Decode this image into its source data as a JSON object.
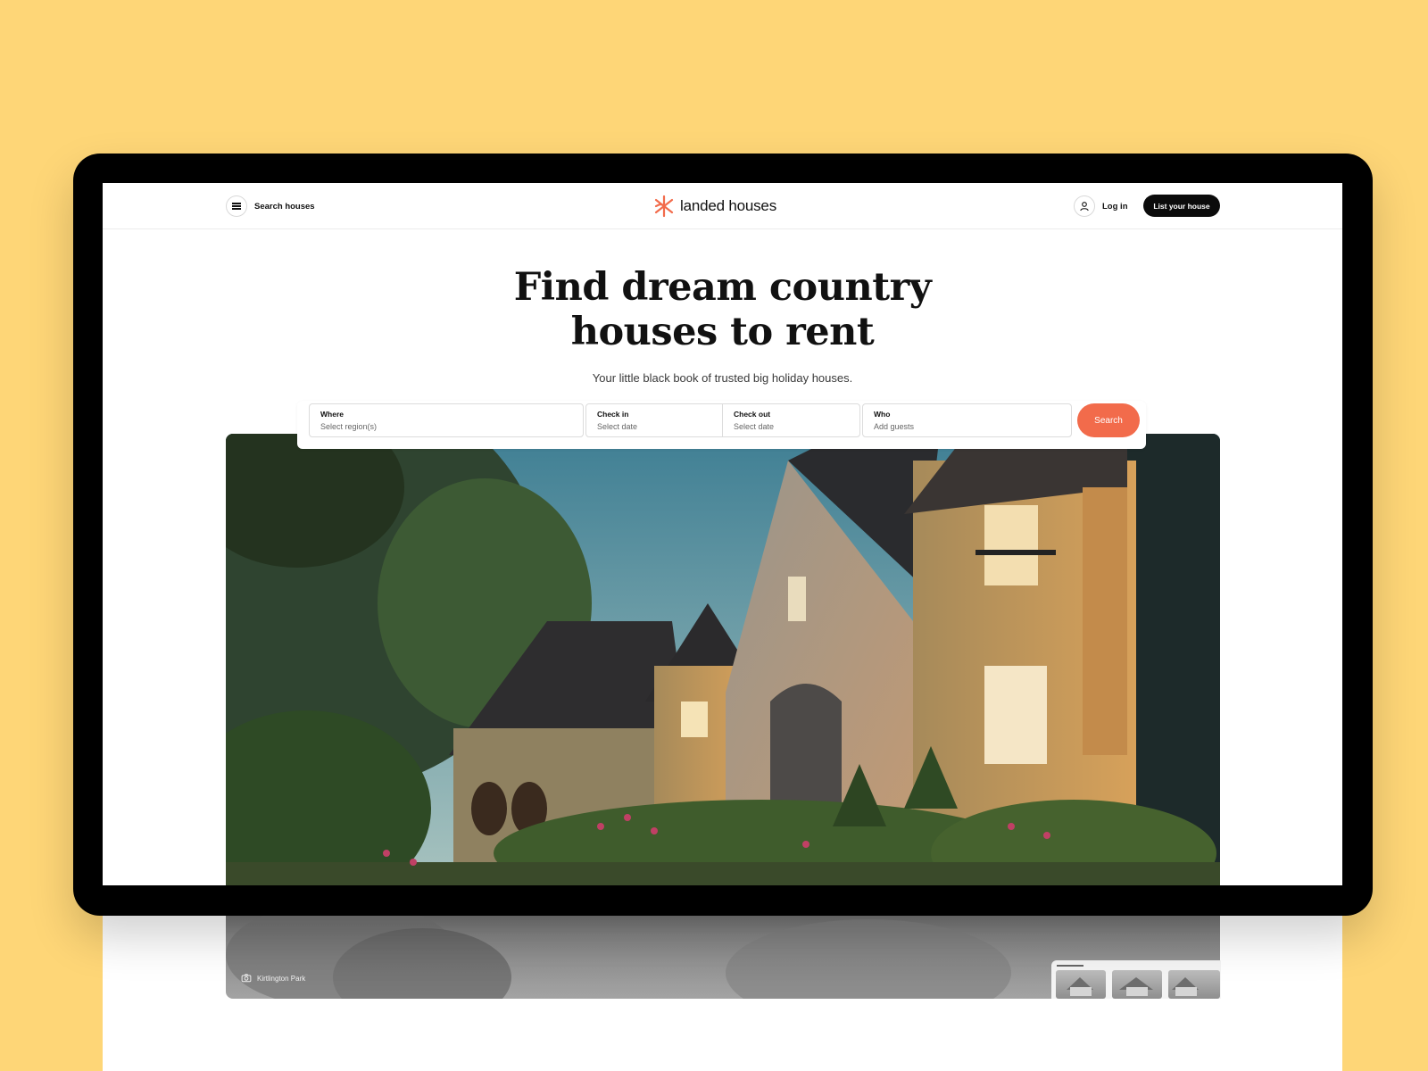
{
  "header": {
    "menu_label": "Search houses",
    "brand": "landed houses",
    "login_label": "Log in",
    "list_button": "List your house"
  },
  "hero": {
    "title_line1": "Find dream country",
    "title_line2": "houses to rent",
    "subtitle": "Your little black book of trusted big holiday houses.",
    "photo_caption": "Kirtlington Park"
  },
  "search": {
    "where_label": "Where",
    "where_value": "Select region(s)",
    "checkin_label": "Check in",
    "checkin_value": "Select date",
    "checkout_label": "Check out",
    "checkout_value": "Select date",
    "who_label": "Who",
    "who_value": "Add guests",
    "button_label": "Search"
  },
  "colors": {
    "background": "#FED677",
    "accent": "#F26B4B",
    "button_dark": "#0B0B0B"
  },
  "icons": [
    "menu-icon",
    "brand-logo-icon",
    "user-icon",
    "camera-icon"
  ]
}
